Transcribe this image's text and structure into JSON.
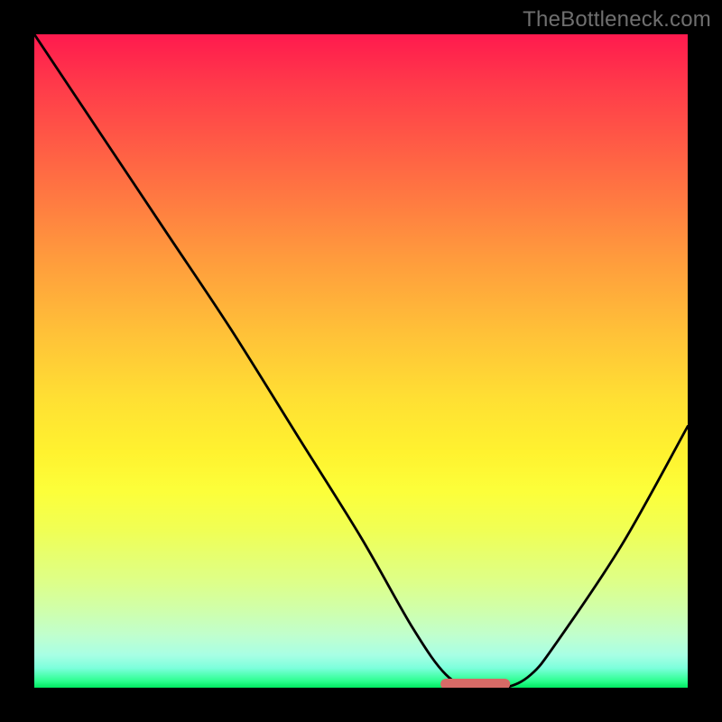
{
  "watermark": "TheBottleneck.com",
  "chart_data": {
    "type": "line",
    "title": "",
    "xlabel": "",
    "ylabel": "",
    "xlim": [
      0,
      100
    ],
    "ylim": [
      0,
      100
    ],
    "series": [
      {
        "name": "bottleneck-curve",
        "x": [
          0,
          10,
          20,
          30,
          40,
          50,
          58,
          63,
          67,
          72,
          76,
          80,
          90,
          100
        ],
        "y": [
          100,
          85,
          70,
          55,
          39,
          23,
          9,
          2,
          0,
          0,
          2,
          7,
          22,
          40
        ]
      }
    ],
    "highlight": {
      "name": "minimum-plateau",
      "x": [
        63,
        67,
        72
      ],
      "y": [
        0,
        0,
        0
      ],
      "color": "#d66a66"
    },
    "background_gradient": {
      "stops": [
        {
          "pos": 0,
          "color": "#ff1a4e"
        },
        {
          "pos": 50,
          "color": "#ffd335"
        },
        {
          "pos": 80,
          "color": "#f4ff55"
        },
        {
          "pos": 100,
          "color": "#00e860"
        }
      ]
    }
  }
}
